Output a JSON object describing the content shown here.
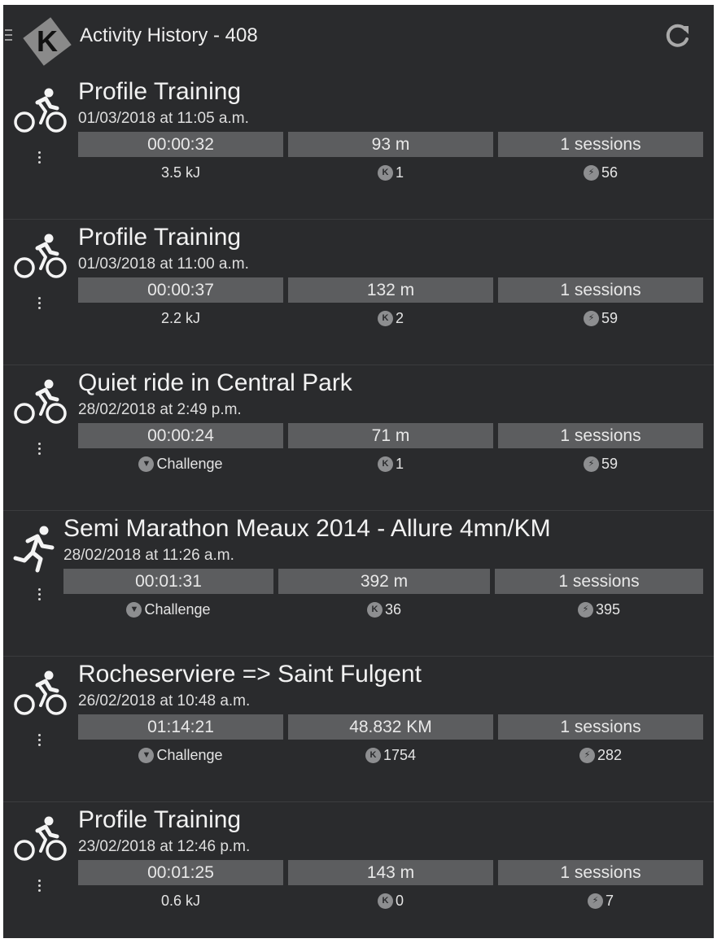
{
  "header": {
    "logo_letter": "K",
    "title": "Activity History - 408",
    "menu_icon": "hamburger-menu-icon",
    "refresh_icon": "refresh-icon"
  },
  "colors": {
    "background": "#2a2b2d",
    "cell": "#5c5d5f",
    "text": "#eeeeee",
    "badge": "#8d8e90"
  },
  "activities": [
    {
      "sport": "cycling",
      "title": "Profile Training",
      "date": "01/03/2018 at 11:05 a.m.",
      "duration": "00:00:32",
      "distance": "93 m",
      "sessions": "1 sessions",
      "stat1": "3.5 kJ",
      "k_points": "1",
      "p_points": "56"
    },
    {
      "sport": "cycling",
      "title": "Profile Training",
      "date": "01/03/2018 at 11:00 a.m.",
      "duration": "00:00:37",
      "distance": "132 m",
      "sessions": "1 sessions",
      "stat1": "2.2 kJ",
      "k_points": "2",
      "p_points": "59"
    },
    {
      "sport": "cycling",
      "title": "Quiet ride in Central Park",
      "date": "28/02/2018 at 2:49 p.m.",
      "duration": "00:00:24",
      "distance": "71 m",
      "sessions": "1 sessions",
      "stat1": "Challenge",
      "k_points": "1",
      "p_points": "59"
    },
    {
      "sport": "running",
      "title": "Semi Marathon Meaux 2014 - Allure 4mn/KM",
      "date": "28/02/2018 at 11:26 a.m.",
      "duration": "00:01:31",
      "distance": "392 m",
      "sessions": "1 sessions",
      "stat1": "Challenge",
      "k_points": "36",
      "p_points": "395"
    },
    {
      "sport": "cycling",
      "title": "Rocheserviere => Saint Fulgent",
      "date": "26/02/2018 at 10:48 a.m.",
      "duration": "01:14:21",
      "distance": "48.832 KM",
      "sessions": "1 sessions",
      "stat1": "Challenge",
      "k_points": "1754",
      "p_points": "282"
    },
    {
      "sport": "cycling",
      "title": "Profile Training",
      "date": "23/02/2018 at 12:46 p.m.",
      "duration": "00:01:25",
      "distance": "143 m",
      "sessions": "1 sessions",
      "stat1": "0.6 kJ",
      "k_points": "0",
      "p_points": "7"
    }
  ]
}
